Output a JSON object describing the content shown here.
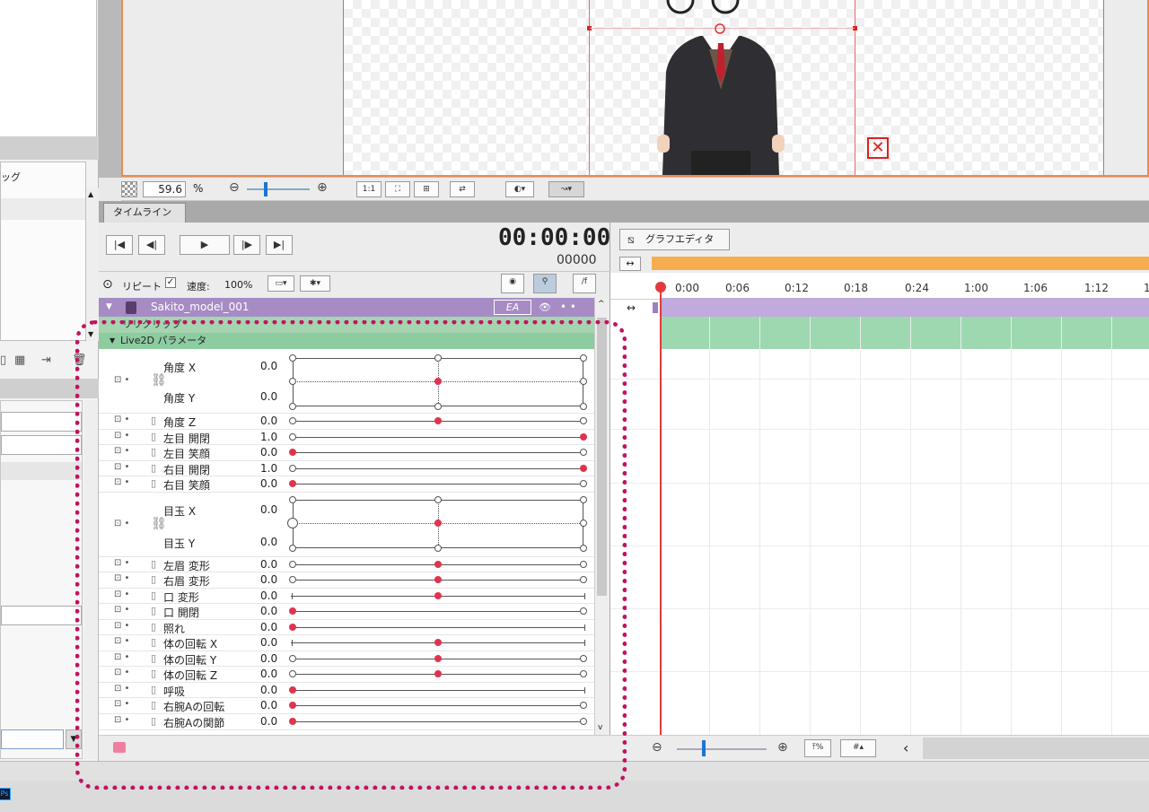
{
  "canvas": {
    "zoom": "59.6",
    "zoom_unit": "%",
    "close_icon": "✕"
  },
  "toolbar": {
    "one_to_one": "1:1"
  },
  "left_panel": {
    "label_1": "ッグ"
  },
  "tabs": [
    {
      "label": "タイムライン"
    }
  ],
  "playback": {
    "timecode": "00:00:00",
    "frames": "00000",
    "repeat_label": "リピート",
    "speed_label": "速度:",
    "speed_value": "100%",
    "fx_label": "/f"
  },
  "model": {
    "name": "Sakito_model_001",
    "ea_label": "EA"
  },
  "clip": {
    "label": "リリクリップ"
  },
  "live2d": {
    "label": "Live2D パラメータ"
  },
  "parameters": [
    {
      "name": "角度 X",
      "value": "0.0"
    },
    {
      "name": "角度 Y",
      "value": "0.0"
    },
    {
      "name": "角度 Z",
      "value": "0.0"
    },
    {
      "name": "左目 開閉",
      "value": "1.0"
    },
    {
      "name": "左目 笑顔",
      "value": "0.0"
    },
    {
      "name": "右目 開閉",
      "value": "1.0"
    },
    {
      "name": "右目 笑顔",
      "value": "0.0"
    },
    {
      "name": "目玉 X",
      "value": "0.0"
    },
    {
      "name": "目玉 Y",
      "value": "0.0"
    },
    {
      "name": "左眉 変形",
      "value": "0.0"
    },
    {
      "name": "右眉 変形",
      "value": "0.0"
    },
    {
      "name": "口 変形",
      "value": "0.0"
    },
    {
      "name": "口 開閉",
      "value": "0.0"
    },
    {
      "name": "照れ",
      "value": "0.0"
    },
    {
      "name": "体の回転 X",
      "value": "0.0"
    },
    {
      "name": "体の回転 Y",
      "value": "0.0"
    },
    {
      "name": "体の回転 Z",
      "value": "0.0"
    },
    {
      "name": "呼吸",
      "value": "0.0"
    },
    {
      "name": "右腕Aの回転",
      "value": "0.0"
    },
    {
      "name": "右腕Aの関節",
      "value": "0.0"
    }
  ],
  "graph_editor": {
    "label": "グラフエディタ"
  },
  "ruler": [
    "0:00",
    "0:06",
    "0:12",
    "0:18",
    "0:24",
    "1:00",
    "1:06",
    "1:12",
    "1"
  ],
  "colors": {
    "accent_orange": "#f08a4b",
    "model_purple": "#a68bc4",
    "param_green": "#8dcba0",
    "keyframe_red": "#e0344e",
    "highlight_magenta": "#c2125f"
  },
  "taskbar": {
    "ps_label": "Ps"
  }
}
